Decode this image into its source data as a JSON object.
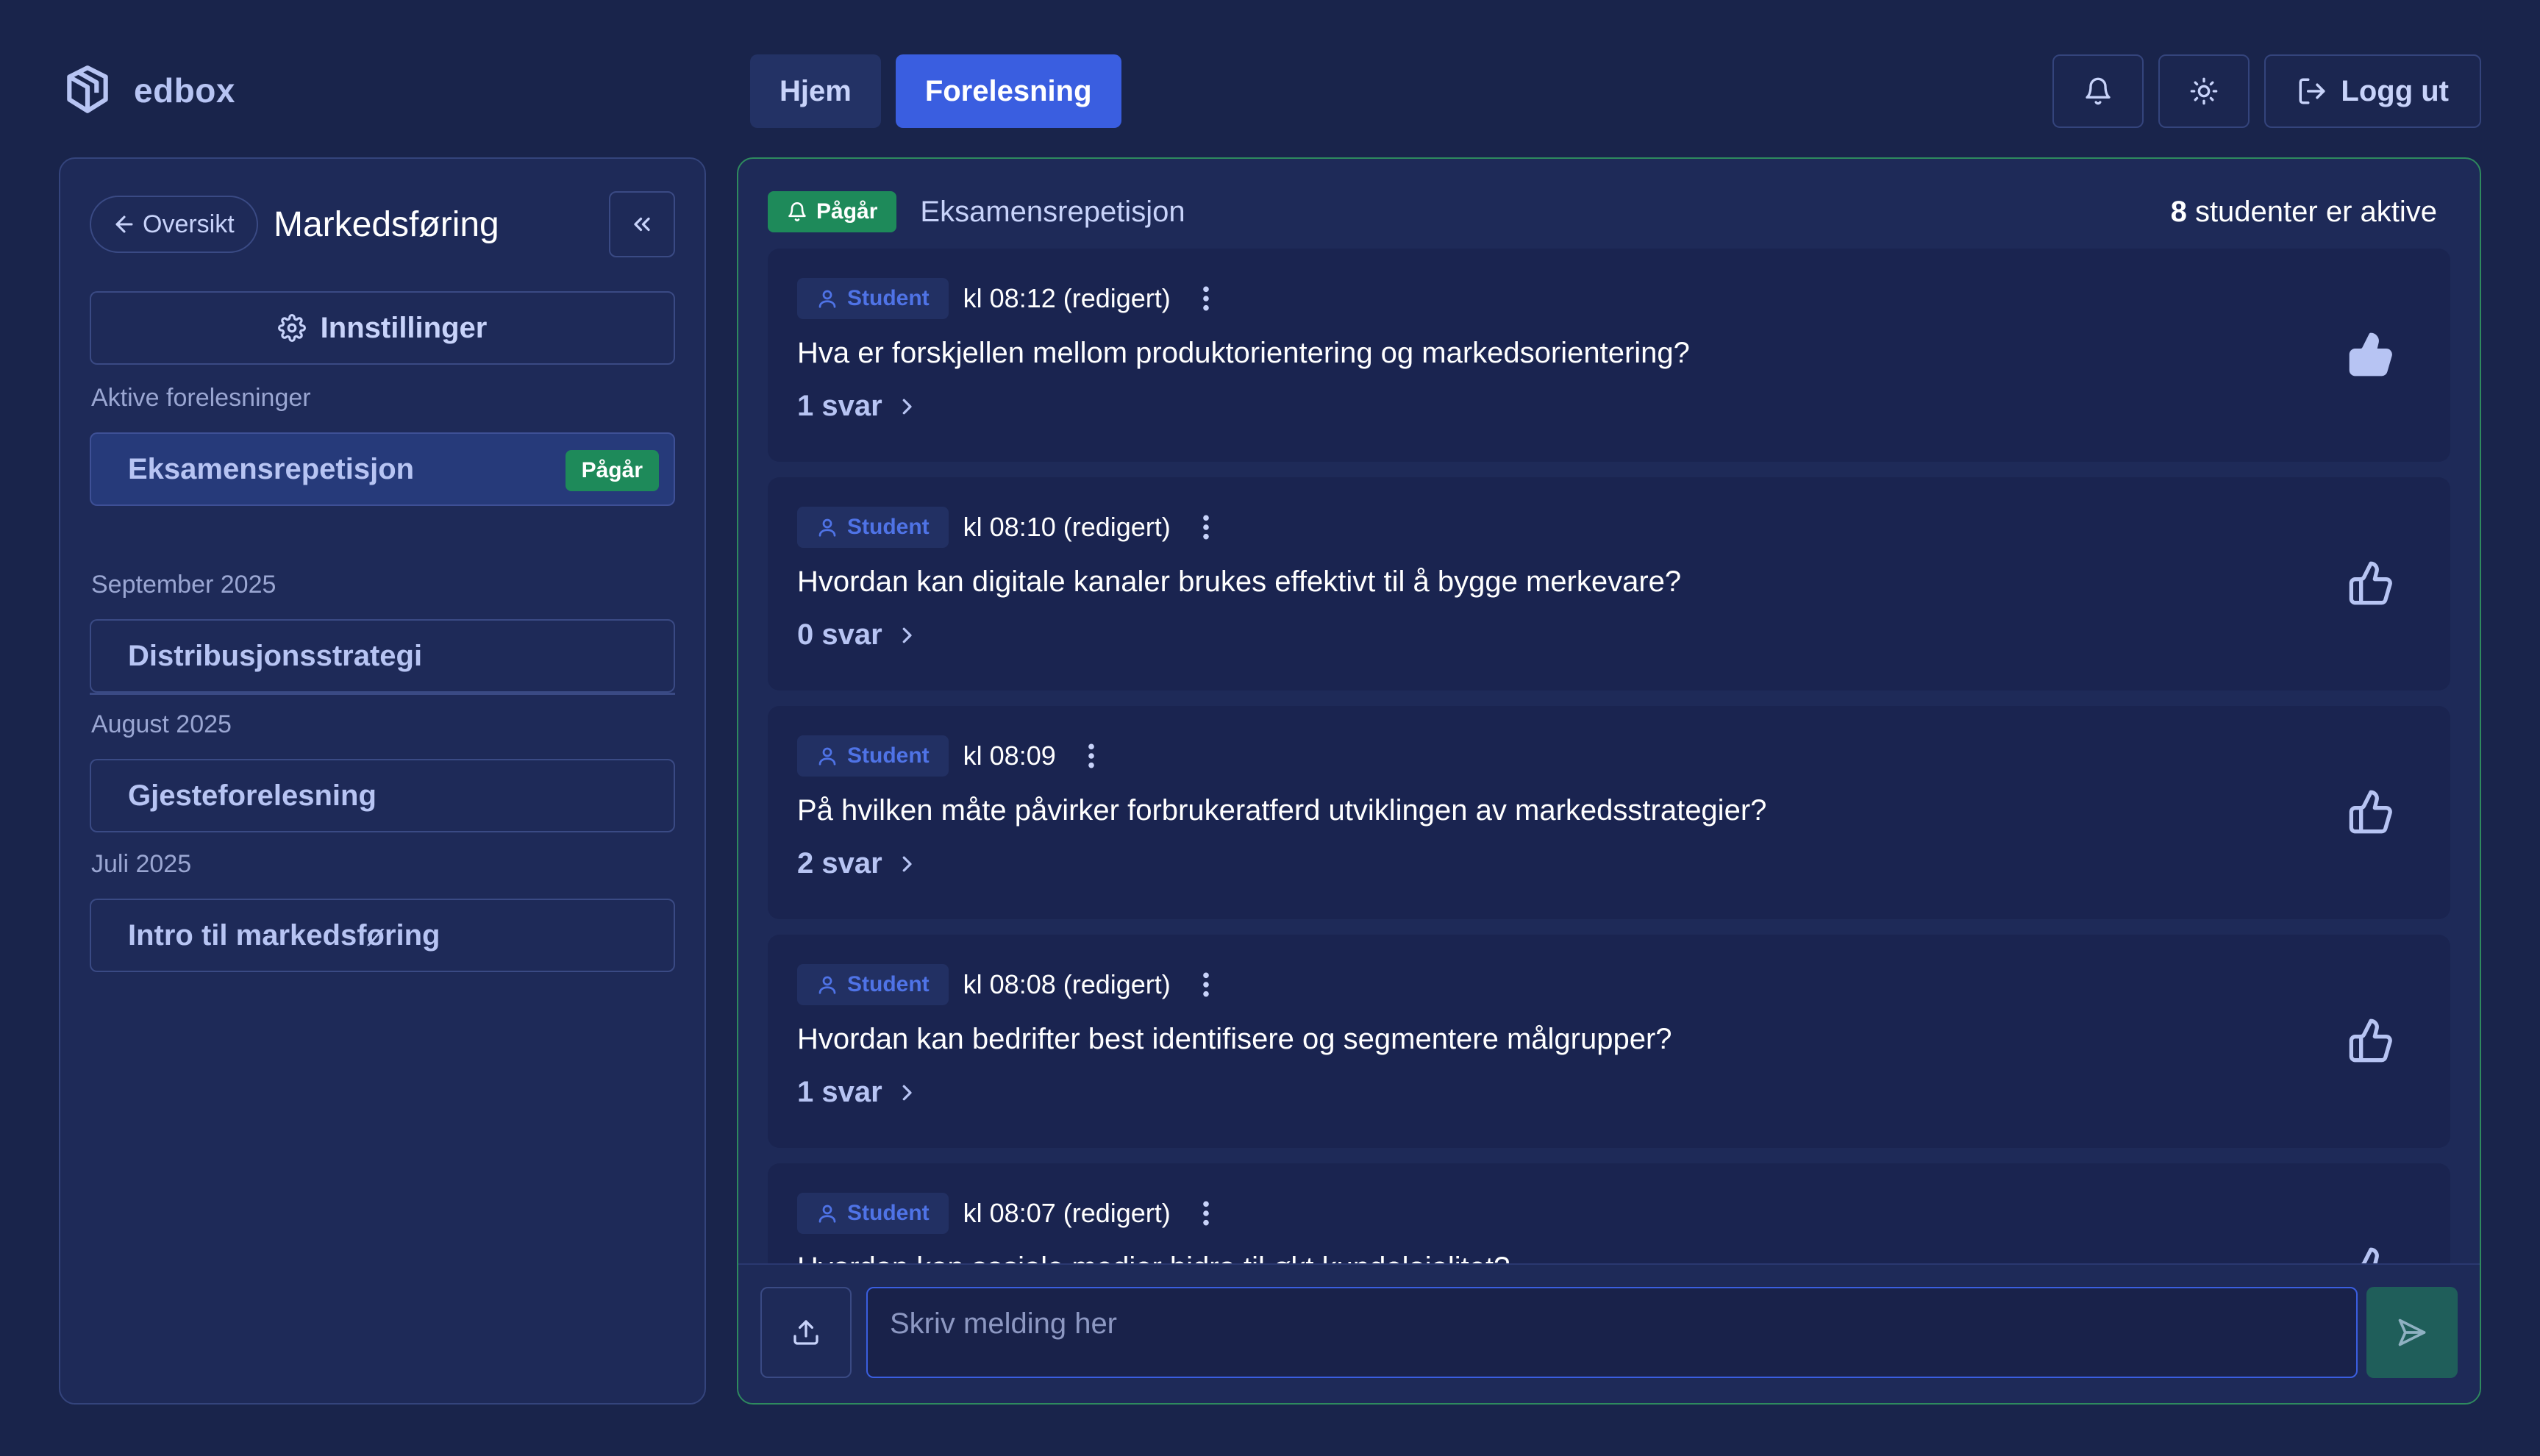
{
  "brand": {
    "name": "edbox"
  },
  "nav": {
    "home": "Hjem",
    "lecture": "Forelesning"
  },
  "top_actions": {
    "logout": "Logg ut"
  },
  "sidebar": {
    "back": "Oversikt",
    "course_title": "Markedsføring",
    "settings": "Innstillinger",
    "active_label": "Aktive forelesninger",
    "active_lecture": {
      "name": "Eksamensrepetisjon",
      "badge": "Pågår"
    },
    "groups": [
      {
        "month": "September 2025",
        "lecture": "Distribusjonsstrategi"
      },
      {
        "month": "August 2025",
        "lecture": "Gjesteforelesning"
      },
      {
        "month": "Juli 2025",
        "lecture": "Intro til markedsføring"
      }
    ]
  },
  "main": {
    "status": "Pågår",
    "lecture_name": "Eksamensrepetisjon",
    "active_count": "8",
    "active_suffix": "studenter er aktive",
    "questions": [
      {
        "role": "Student",
        "time": "kl 08:12 (redigert)",
        "text": "Hva er forskjellen mellom produktorientering og markedsorientering?",
        "replies": "1 svar",
        "liked": true
      },
      {
        "role": "Student",
        "time": "kl 08:10 (redigert)",
        "text": "Hvordan kan digitale kanaler brukes effektivt til å bygge merkevare?",
        "replies": "0 svar",
        "liked": false
      },
      {
        "role": "Student",
        "time": "kl 08:09",
        "text": "På hvilken måte påvirker forbrukeratferd utviklingen av markedsstrategier?",
        "replies": "2 svar",
        "liked": false
      },
      {
        "role": "Student",
        "time": "kl 08:08 (redigert)",
        "text": "Hvordan kan bedrifter best identifisere og segmentere målgrupper?",
        "replies": "1 svar",
        "liked": false
      },
      {
        "role": "Student",
        "time": "kl 08:07 (redigert)",
        "text": "Hvordan kan sosiale medier bidra til økt kundelojalitet?",
        "replies": "",
        "liked": false
      }
    ],
    "composer": {
      "placeholder": "Skriv melding her"
    }
  },
  "colors": {
    "background": "#19244b",
    "panel": "#1e2a58",
    "accent": "#3a5ee0",
    "live_green": "#1e8a5a",
    "student_blue": "#4f73e6"
  },
  "icons": [
    "logo-cube-icon",
    "bell-icon",
    "sun-icon",
    "logout-icon",
    "arrow-left-icon",
    "chevrons-left-icon",
    "gear-icon",
    "user-icon",
    "more-vertical-icon",
    "chevron-right-icon",
    "thumbs-up-icon",
    "upload-icon",
    "send-icon"
  ]
}
